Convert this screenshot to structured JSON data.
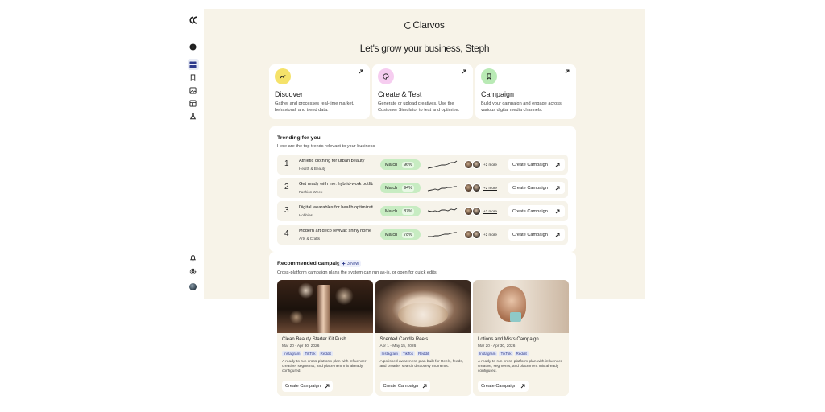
{
  "brand": {
    "name": "Clarvos"
  },
  "greeting": "Let's grow your business, Steph",
  "sidebar": {
    "items": [
      {
        "icon": "plus-circle-icon"
      },
      {
        "icon": "grid-icon",
        "active": true
      },
      {
        "icon": "bookmark-icon"
      },
      {
        "icon": "image-icon"
      },
      {
        "icon": "gallery-icon"
      },
      {
        "icon": "flask-icon"
      }
    ],
    "bottom": [
      {
        "icon": "bell-icon"
      },
      {
        "icon": "gear-icon"
      }
    ]
  },
  "features": [
    {
      "title": "Discover",
      "desc": "Gather and processes real-time market, behavioral, and trend data.",
      "color": "#f5e26a",
      "icon": "trend-icon"
    },
    {
      "title": "Create & Test",
      "desc": "Generate or upload creatives. Use the Customer Simulator to test and optimize.",
      "color": "#f6cdf0",
      "icon": "palette-icon"
    },
    {
      "title": "Campaign",
      "desc": "Build your campaign and engage across various digital media channels.",
      "color": "#b9eab5",
      "icon": "bookmark-icon"
    }
  ],
  "trending": {
    "title": "Trending for you",
    "subtitle": "Here are the top trends relevant to your business",
    "match_label": "Match",
    "more_label": "+2 more",
    "button_label": "Create Campaign",
    "rows": [
      {
        "rank": "1",
        "name": "Athletic clothing for urban beauty",
        "category": "Health & Beauty",
        "match": "96%"
      },
      {
        "rank": "2",
        "name": "Get ready with me: hybrid-work outfits",
        "category": "Fashion Week",
        "match": "94%"
      },
      {
        "rank": "3",
        "name": "Digital wearables for health optimization",
        "category": "Hobbies",
        "match": "87%"
      },
      {
        "rank": "4",
        "name": "Modern art deco revival: shiny home decor",
        "category": "Arts & Crafts",
        "match": "78%"
      }
    ]
  },
  "recommended": {
    "title": "Recommended campaigns",
    "badge": "3 New",
    "subtitle": "Cross-platform campaign plans the system can run as-is, or open for quick edits.",
    "button_label": "Create Campaign",
    "cards": [
      {
        "name": "Clean Beauty Starter Kit Push",
        "date": "Mar 20 - Apr 30, 2026",
        "tags": [
          "Instagram",
          "TikTok",
          "Reddit"
        ],
        "desc": "A ready-to-run cross-platform plan with influencer creative, segments, and placement mix already configured."
      },
      {
        "name": "Scented Candle Reels",
        "date": "Apr 1 - May 15, 2026",
        "tags": [
          "Instagram",
          "TikTok",
          "Reddit"
        ],
        "desc": "A polished awareness plan built for Reels, feeds, and broader search discovery moments."
      },
      {
        "name": "Lotions and Mists Campaign",
        "date": "Mar 20 - Apr 30, 2026",
        "tags": [
          "Instagram",
          "TikTok",
          "Reddit"
        ],
        "desc": "A ready-to-run cross-platform plan with influencer creative, segments, and placement mix already configured."
      }
    ]
  }
}
